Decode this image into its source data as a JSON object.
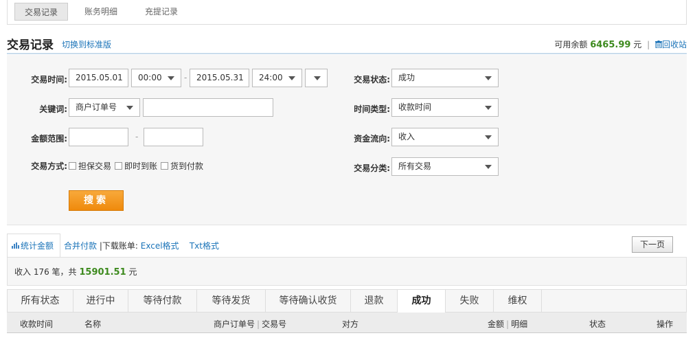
{
  "top_tabs": [
    "交易记录",
    "账务明细",
    "充提记录"
  ],
  "title": {
    "text": "交易记录",
    "switch_link": "切换到标准版",
    "balance_label": "可用余额",
    "balance_amount": "6465.99",
    "balance_unit": "元",
    "separator": "|",
    "recycle_link": "回收站"
  },
  "filters": {
    "time": {
      "label": "交易时间:",
      "start_date": "2015.05.01",
      "start_time": "00:00",
      "dash": "-",
      "end_date": "2015.05.31",
      "end_time": "24:00"
    },
    "keyword": {
      "label": "关键词:",
      "type": "商户订单号",
      "value": ""
    },
    "amount": {
      "label": "金额范围:",
      "dash": "-",
      "min": "",
      "max": ""
    },
    "method": {
      "label": "交易方式:",
      "options": [
        "担保交易",
        "即时到账",
        "货到付款"
      ]
    },
    "status": {
      "label": "交易状态:",
      "value": "成功"
    },
    "time_type": {
      "label": "时间类型:",
      "value": "收款时间"
    },
    "flow": {
      "label": "资金流向:",
      "value": "收入"
    },
    "category": {
      "label": "交易分类:",
      "value": "所有交易"
    },
    "search_button": "搜索"
  },
  "stats": {
    "tab_label": "统计金额",
    "merge_link": "合并付款",
    "download_prefix": "|下载账单:",
    "excel_link": "Excel格式",
    "txt_link": "Txt格式",
    "next_page": "下一页"
  },
  "summary": {
    "prefix": "收入 176 笔，共",
    "amount": "15901.51",
    "unit": "元"
  },
  "status_tabs": [
    "所有状态",
    "进行中",
    "等待付款",
    "等待发货",
    "等待确认收货",
    "退款",
    "成功",
    "失败",
    "维权"
  ],
  "active_status_tab": 6,
  "table_headers": {
    "time": "收款时间",
    "name": "名称",
    "order_no": "商户订单号",
    "pipe": "|",
    "trade_no": "交易号",
    "party": "对方",
    "amount": "金额",
    "detail": "明细",
    "status": "状态",
    "action": "操作"
  },
  "icons": {
    "trash": "trash-icon",
    "chart": "bar-chart-icon",
    "dropdown": "chevron-down-icon"
  },
  "colors": {
    "link": "#1a73b8",
    "amount": "#3d8a1e",
    "search_button": "#f29811"
  }
}
